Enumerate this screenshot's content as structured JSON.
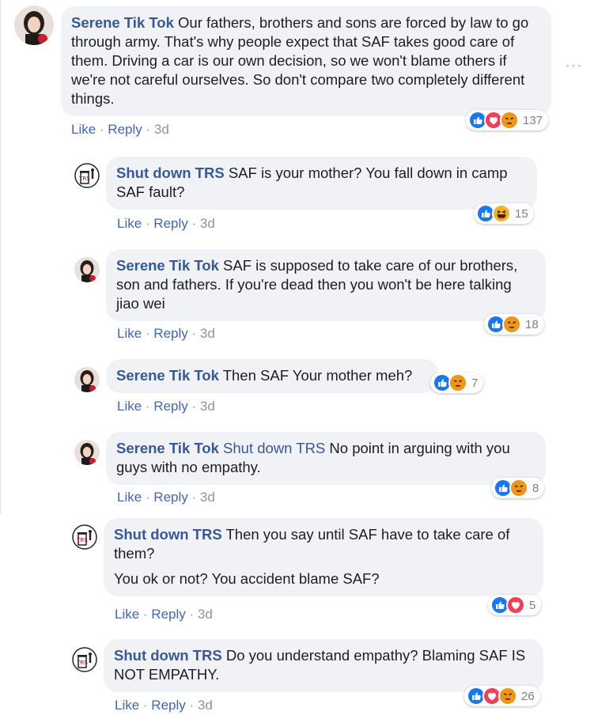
{
  "more_label": "⋯",
  "c1": {
    "author": "Serene Tik Tok",
    "text": "Our fathers, brothers and sons are forced by law to go through army. That's why people expect that SAF takes good care of them. Driving a car is our own decision, so we won't blame others if we're not careful ourselves. So don't compare two completely different things.",
    "like": "Like",
    "sep1": " · ",
    "reply": "Reply",
    "sep2": " · ",
    "time": "3d",
    "count": "137",
    "reactions": [
      "like-icon",
      "love-icon",
      "angry-icon"
    ]
  },
  "c2": {
    "author": "Shut down TRS",
    "text": "SAF is your mother? You fall down in camp SAF fault?",
    "like": "Like",
    "sep1": " · ",
    "reply": "Reply",
    "sep2": " · ",
    "time": "3d",
    "count": "15",
    "reactions": [
      "like-icon",
      "haha-icon"
    ]
  },
  "c3": {
    "author": "Serene Tik Tok",
    "text": "SAF is supposed to take care of our brothers, son and fathers. If you're dead then you won't be here talking jiao wei",
    "like": "Like",
    "sep1": " · ",
    "reply": "Reply",
    "sep2": " · ",
    "time": "3d",
    "count": "18",
    "reactions": [
      "like-icon",
      "angry-icon"
    ]
  },
  "c4": {
    "author": "Serene Tik Tok",
    "text": "Then SAF Your mother meh?",
    "like": "Like",
    "sep1": " · ",
    "reply": "Reply",
    "sep2": " · ",
    "time": "3d",
    "count": "7",
    "reactions": [
      "like-icon",
      "angry-icon"
    ]
  },
  "c5": {
    "author": "Serene Tik Tok",
    "mention": "Shut down TRS",
    "text": "No point in arguing with you guys with no empathy.",
    "like": "Like",
    "sep1": " · ",
    "reply": "Reply",
    "sep2": " · ",
    "time": "3d",
    "count": "8",
    "reactions": [
      "like-icon",
      "angry-icon"
    ]
  },
  "c6": {
    "author": "Shut down TRS",
    "text": "Then you say until SAF have to take care of them?",
    "text2": "You ok or not? You accident blame SAF?",
    "like": "Like",
    "sep1": " · ",
    "reply": "Reply",
    "sep2": " · ",
    "time": "3d",
    "count": "5",
    "reactions": [
      "like-icon",
      "love-icon"
    ]
  },
  "c7": {
    "author": "Shut down TRS",
    "text": "Do you understand empathy? Blaming SAF IS NOT EMPATHY.",
    "like": "Like",
    "sep1": " · ",
    "reply": "Reply",
    "sep2": " · ",
    "time": "3d",
    "count": "26",
    "reactions": [
      "like-icon",
      "love-icon",
      "angry-icon"
    ]
  },
  "colors": {
    "name": "#385898",
    "link": "#4267b2",
    "meta": "#90949c",
    "bubble": "#f0f2f5",
    "like": "#1877f2",
    "love": "#f33e58",
    "angry": "#e9710f"
  }
}
